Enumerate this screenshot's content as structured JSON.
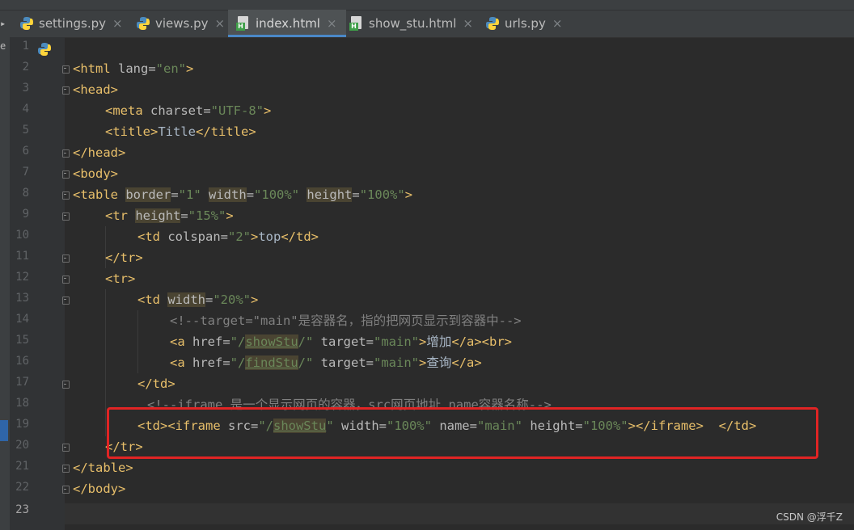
{
  "tabs": [
    {
      "label": "settings.py",
      "icon": "python-file-icon",
      "active": false
    },
    {
      "label": "views.py",
      "icon": "python-file-icon",
      "active": false
    },
    {
      "label": "index.html",
      "icon": "html-file-icon",
      "active": true
    },
    {
      "label": "show_stu.html",
      "icon": "html-file-icon",
      "active": false
    },
    {
      "label": "urls.py",
      "icon": "python-file-icon",
      "active": false
    }
  ],
  "close_glyph": "×",
  "left_edge_text": "e",
  "line_numbers": [
    "1",
    "2",
    "3",
    "4",
    "5",
    "6",
    "7",
    "8",
    "9",
    "10",
    "11",
    "12",
    "13",
    "14",
    "15",
    "16",
    "17",
    "18",
    "19",
    "20",
    "21",
    "22",
    "23"
  ],
  "code": {
    "l2": {
      "a": "<html ",
      "b": "lang=",
      "c": "\"en\"",
      "d": ">"
    },
    "l3": "<head>",
    "l4": {
      "a": "<meta ",
      "b": "charset=",
      "c": "\"UTF-8\"",
      "d": ">"
    },
    "l5": {
      "a": "<title>",
      "b": "Title",
      "c": "</title>"
    },
    "l6": "</head>",
    "l7": "<body>",
    "l8": {
      "a": "<table ",
      "b": "border",
      "c": "=",
      "d": "\"1\"",
      "e": " ",
      "f": "width",
      "g": "=",
      "h": "\"100%\"",
      "i": " ",
      "j": "height",
      "k": "=",
      "l": "\"100%\"",
      "m": ">"
    },
    "l9": {
      "a": "<tr ",
      "b": "height",
      "c": "=",
      "d": "\"15%\"",
      "e": ">"
    },
    "l10": {
      "a": "<td ",
      "b": "colspan=",
      "c": "\"2\"",
      "d": ">",
      "e": "top",
      "f": "</td>"
    },
    "l11": "</tr>",
    "l12": "<tr>",
    "l13": {
      "a": "<td ",
      "b": "width",
      "c": "=",
      "d": "\"20%\"",
      "e": ">"
    },
    "l14": "<!--target=\"main\"是容器名，指的把网页显示到容器中-->",
    "l15": {
      "a": "<a ",
      "b": "href=",
      "c": "\"/",
      "d": "showStu",
      "e": "/\"",
      "f": " target=",
      "g": "\"main\"",
      "h": ">",
      "i": "增加",
      "j": "</a><br>"
    },
    "l16": {
      "a": "<a ",
      "b": "href=",
      "c": "\"/",
      "d": "findStu",
      "e": "/\"",
      "f": " target=",
      "g": "\"main\"",
      "h": ">",
      "i": "查询",
      "j": "</a>"
    },
    "l17": "</td>",
    "l18": "<!--iframe 是一个显示网页的容器，src网页地址 name容器名称-->",
    "l19": {
      "a": "<td><iframe ",
      "b": "src=",
      "c": "\"/",
      "d": "showStu",
      "e": "\"",
      "f": " width=",
      "g": "\"100%\"",
      "h": " name=",
      "i": "\"main\"",
      "j": " height=",
      "k": "\"100%\"",
      "l": "></iframe>",
      "m": "  </td>"
    },
    "l20": "</tr>",
    "l21": "</table>",
    "l22": "</body>"
  },
  "watermark": "CSDN @浮千Z",
  "colors": {
    "accent": "#4a88c7",
    "highlight_box": "#e02424",
    "tag": "#e8bf6a",
    "string": "#6a8759"
  }
}
